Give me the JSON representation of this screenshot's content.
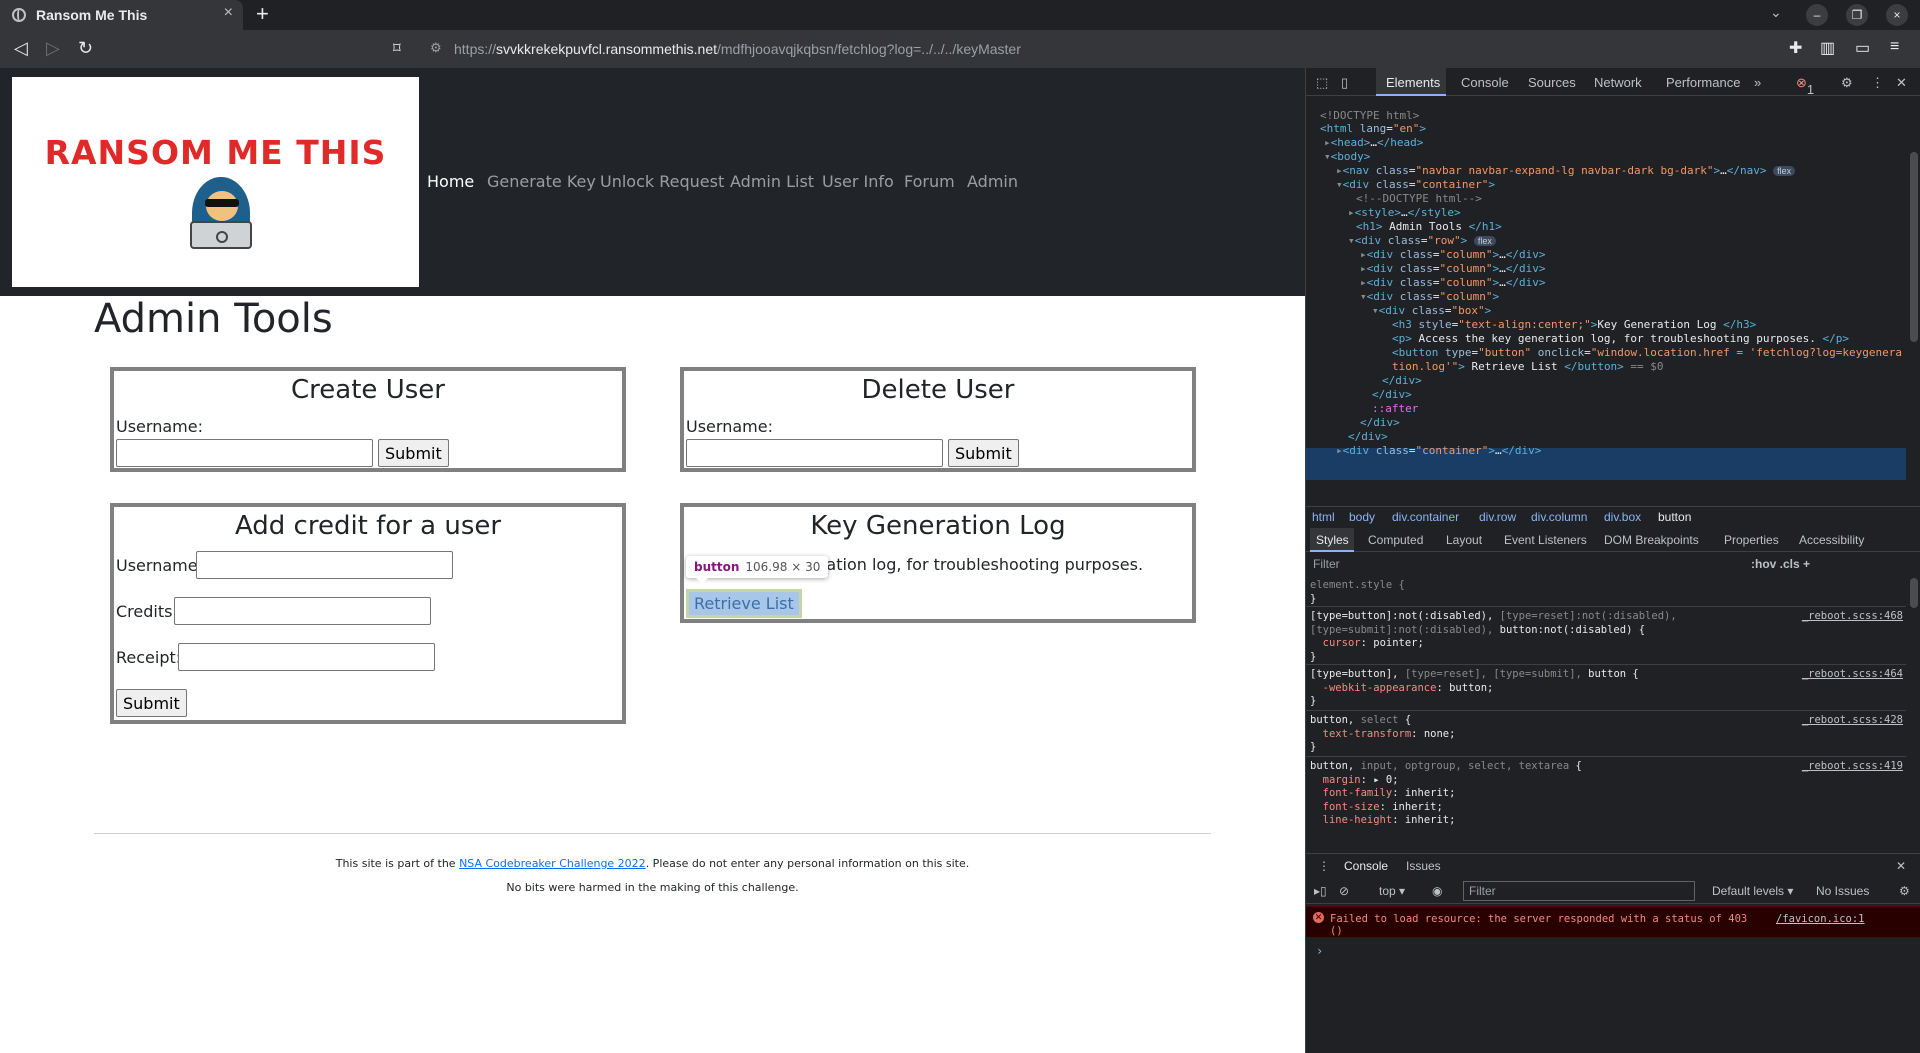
{
  "browser": {
    "tab_title": "Ransom Me This",
    "tab_close": "×",
    "new_tab": "+",
    "url_host": "svvkkrekekpuvfcl.ransommethis.net",
    "url_scheme": "https://",
    "url_path": "/mdfhjooavqjkqbsn/fetchlog?log=../../../keyMaster",
    "window_controls": [
      "–",
      "❐",
      "×"
    ]
  },
  "site": {
    "logo_text": "RANSOM ME THIS",
    "nav": [
      "Home",
      "Generate Key",
      "Unlock Request",
      "Admin List",
      "User Info",
      "Forum",
      "Admin"
    ],
    "heading": "Admin Tools",
    "create_user": {
      "title": "Create User",
      "label": "Username:",
      "submit": "Submit"
    },
    "delete_user": {
      "title": "Delete User",
      "label": "Username:",
      "submit": "Submit"
    },
    "add_credit": {
      "title": "Add credit for a user",
      "username": "Username:",
      "credits": "Credits:",
      "receipt": "Receipt:",
      "submit": "Submit"
    },
    "key_log": {
      "title": "Key Generation Log",
      "desc_visible": "eration log, for troubleshooting purposes.",
      "button": "Retrieve List"
    },
    "tooltip": {
      "tag": "button",
      "dims": "106.98 × 30"
    },
    "footer": {
      "line1_pre": "This site is part of the ",
      "line1_link": "NSA Codebreaker Challenge 2022",
      "line1_post": ". Please do not enter any personal information on this site.",
      "line2": "No bits were harmed in the making of this challenge."
    }
  },
  "devtools": {
    "tabs": [
      "Elements",
      "Console",
      "Sources",
      "Network",
      "Performance"
    ],
    "more": "»",
    "error_count": "1",
    "breadcrumbs": [
      "html",
      "body",
      "div.container",
      "div.row",
      "div.column",
      "div.box",
      "button"
    ],
    "style_tabs": [
      "Styles",
      "Computed",
      "Layout",
      "Event Listeners",
      "DOM Breakpoints",
      "Properties",
      "Accessibility"
    ],
    "filter_placeholder": "Filter",
    "filter_opts": ":hov  .cls  +",
    "console_tabs": [
      "Console",
      "Issues"
    ],
    "console_context": "top ▾",
    "console_filter": "Filter",
    "console_levels": "Default levels ▾",
    "console_issues": "No Issues",
    "error_msg": "Failed to load resource: the server responded with a status of 403\n()",
    "error_src": "/favicon.ico:1"
  }
}
